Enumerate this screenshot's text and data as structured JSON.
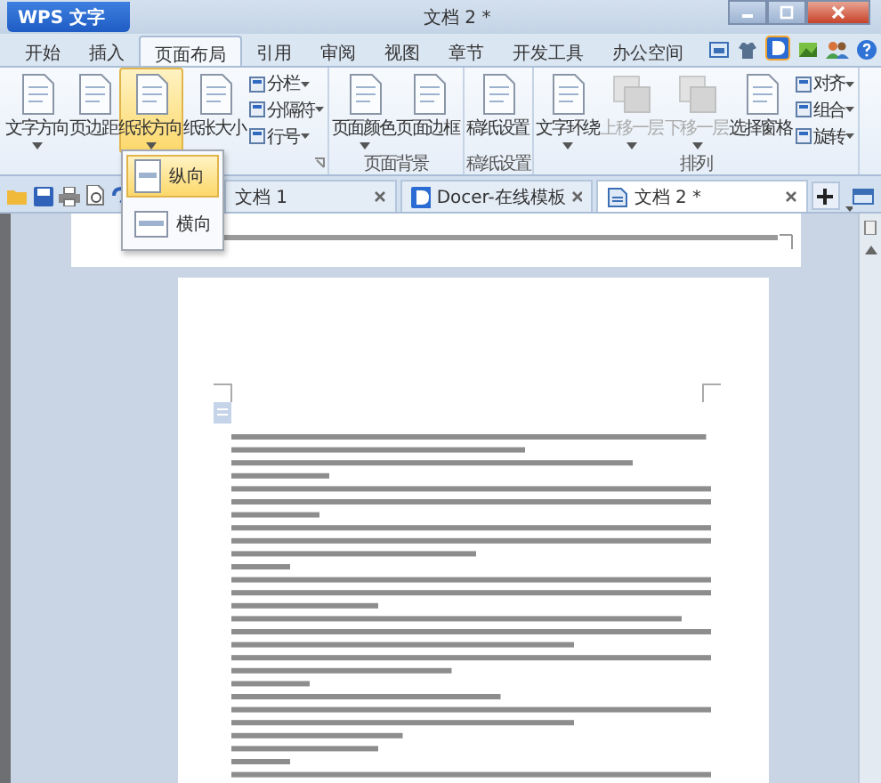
{
  "app_button": {
    "label": "WPS 文字"
  },
  "window": {
    "title": "文档 2 *"
  },
  "menu_tabs": [
    {
      "label": "开始",
      "selected": false
    },
    {
      "label": "插入",
      "selected": false
    },
    {
      "label": "页面布局",
      "selected": true
    },
    {
      "label": "引用",
      "selected": false
    },
    {
      "label": "审阅",
      "selected": false
    },
    {
      "label": "视图",
      "selected": false
    },
    {
      "label": "章节",
      "selected": false
    },
    {
      "label": "开发工具",
      "selected": false
    },
    {
      "label": "办公空间",
      "selected": false
    }
  ],
  "ribbon": {
    "groups": [
      {
        "launcher": true,
        "items": [
          {
            "kind": "large",
            "label": "文字方向",
            "dropdown": true,
            "expanded": false,
            "disabled": false
          },
          {
            "kind": "large",
            "label": "页边距",
            "dropdown": false,
            "expanded": false,
            "disabled": false
          },
          {
            "kind": "large",
            "label": "纸张方向",
            "dropdown": true,
            "expanded": true,
            "disabled": false
          },
          {
            "kind": "large",
            "label": "纸张大小",
            "dropdown": false,
            "expanded": false,
            "disabled": false
          },
          {
            "kind": "small",
            "entries": [
              {
                "label": "分栏",
                "dropdown": true
              },
              {
                "label": "分隔符",
                "dropdown": true
              },
              {
                "label": "行号",
                "dropdown": true
              }
            ]
          }
        ]
      },
      {
        "label": "页面背景",
        "launcher": false,
        "items": [
          {
            "kind": "large",
            "label": "页面颜色",
            "dropdown": true,
            "expanded": false,
            "disabled": false
          },
          {
            "kind": "large",
            "label": "页面边框",
            "dropdown": false,
            "expanded": false,
            "disabled": false
          }
        ]
      },
      {
        "label": "稿纸设置",
        "launcher": false,
        "items": [
          {
            "kind": "large",
            "label": "稿纸设置",
            "dropdown": false,
            "expanded": false,
            "disabled": false
          }
        ]
      },
      {
        "label": "排列",
        "launcher": false,
        "items": [
          {
            "kind": "large",
            "label": "文字环绕",
            "dropdown": true,
            "expanded": false,
            "disabled": false
          },
          {
            "kind": "large",
            "label": "上移一层",
            "dropdown": true,
            "expanded": false,
            "disabled": true
          },
          {
            "kind": "large",
            "label": "下移一层",
            "dropdown": true,
            "expanded": false,
            "disabled": true
          },
          {
            "kind": "large",
            "label": "选择窗格",
            "dropdown": false,
            "expanded": false,
            "disabled": false
          },
          {
            "kind": "small",
            "entries": [
              {
                "label": "对齐",
                "dropdown": true
              },
              {
                "label": "组合",
                "dropdown": true
              },
              {
                "label": "旋转",
                "dropdown": true
              }
            ]
          }
        ]
      }
    ]
  },
  "doc_tabs": [
    {
      "label": "文档 1",
      "selected": false
    },
    {
      "label": "Docer-在线模板",
      "selected": false
    },
    {
      "label": "文档 2 *",
      "selected": true
    }
  ],
  "orientation_menu": [
    {
      "label": "纵向",
      "selected": true
    },
    {
      "label": "横向",
      "selected": false
    }
  ]
}
